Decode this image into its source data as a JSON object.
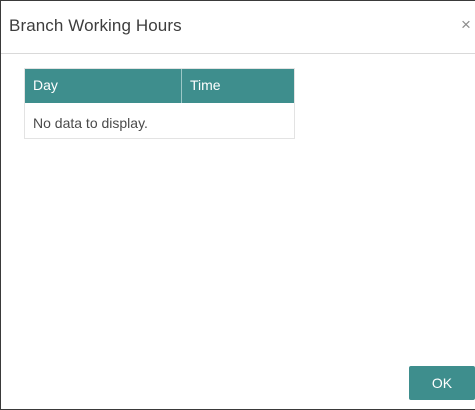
{
  "dialog": {
    "title": "Branch Working Hours",
    "close_glyph": "×",
    "close_icon": "close-icon"
  },
  "table": {
    "columns": [
      "Day",
      "Time"
    ],
    "empty_message": "No data to display."
  },
  "footer": {
    "ok_label": "OK"
  },
  "colors": {
    "accent": "#3e8e8d",
    "title_text": "#3d3d3d",
    "body_text": "#4a4a4a"
  }
}
